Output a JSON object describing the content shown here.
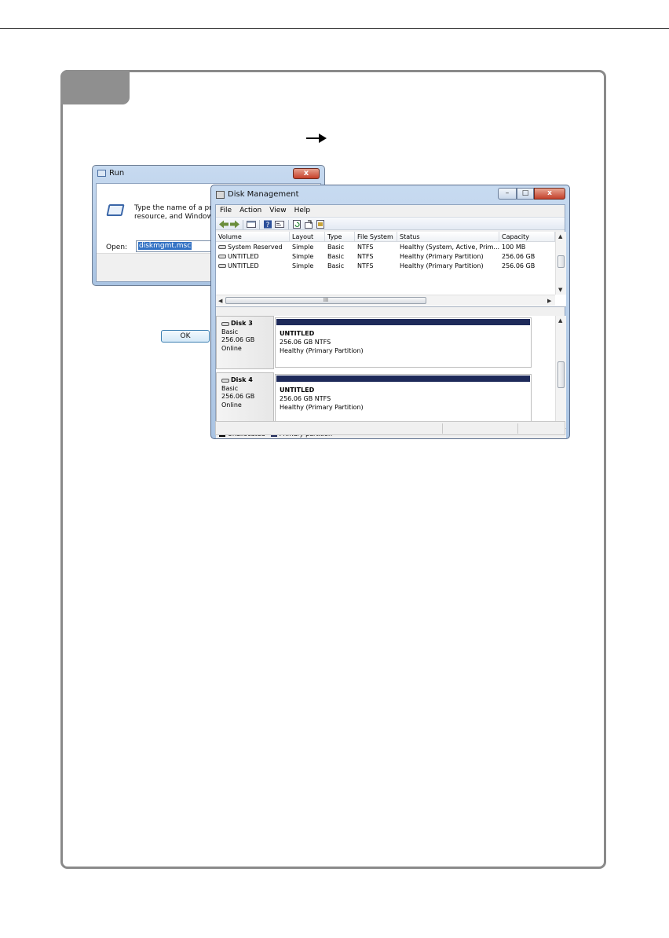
{
  "run_dialog": {
    "title": "Run",
    "close_label": "x",
    "description_line1": "Type the name of a progra",
    "description_line2": "resource, and Windows wi",
    "open_label": "Open:",
    "open_value": "diskmgmt.msc",
    "ok_label": "OK"
  },
  "disk_mgmt": {
    "title": "Disk Management",
    "controls": {
      "minimize": "–",
      "maximize": "□",
      "close": "x"
    },
    "menu": [
      "File",
      "Action",
      "View",
      "Help"
    ],
    "columns": [
      "Volume",
      "Layout",
      "Type",
      "File System",
      "Status",
      "Capacity"
    ],
    "volumes": [
      {
        "volume": "System Reserved",
        "layout": "Simple",
        "type": "Basic",
        "fs": "NTFS",
        "status": "Healthy (System, Active, Prim...",
        "capacity": "100 MB"
      },
      {
        "volume": "UNTITLED",
        "layout": "Simple",
        "type": "Basic",
        "fs": "NTFS",
        "status": "Healthy (Primary Partition)",
        "capacity": "256.06 GB"
      },
      {
        "volume": "UNTITLED",
        "layout": "Simple",
        "type": "Basic",
        "fs": "NTFS",
        "status": "Healthy (Primary Partition)",
        "capacity": "256.06 GB"
      }
    ],
    "hscroll_grip": "III",
    "disks": [
      {
        "name": "Disk 3",
        "kind": "Basic",
        "size": "256.06 GB",
        "state": "Online",
        "partition_name": "UNTITLED",
        "partition_size": "256.06 GB NTFS",
        "partition_status": "Healthy (Primary Partition)"
      },
      {
        "name": "Disk 4",
        "kind": "Basic",
        "size": "256.06 GB",
        "state": "Online",
        "partition_name": "UNTITLED",
        "partition_size": "256.06 GB NTFS",
        "partition_status": "Healthy (Primary Partition)"
      }
    ],
    "legend": [
      {
        "label": "Unallocated",
        "color": "#000000"
      },
      {
        "label": "Primary partition",
        "color": "#1e2a5a"
      }
    ]
  },
  "colors": {
    "frame": "#8a8a8a",
    "tab": "#8f8f8f",
    "partition_bar": "#1e2a5a",
    "selection": "#3372c4"
  }
}
